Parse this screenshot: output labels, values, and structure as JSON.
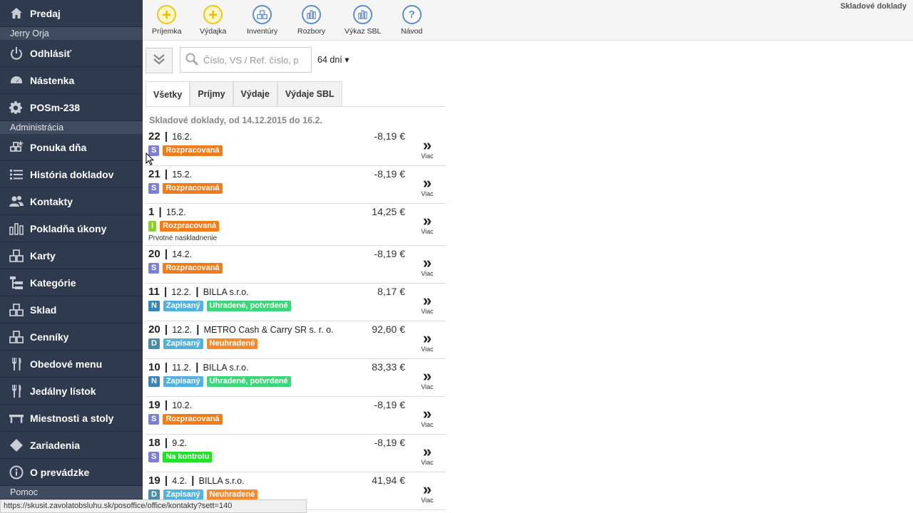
{
  "sidebar": {
    "top_item": {
      "label": "Predaj",
      "icon": "home-icon"
    },
    "user_name": "Jerry Orja",
    "logout": {
      "label": "Odhlásiť",
      "icon": "power-icon"
    },
    "dashboard": {
      "label": "Nástenka",
      "icon": "dashboard-icon"
    },
    "pos": {
      "label": "POSm-238",
      "icon": "gear-icon"
    },
    "admin_section": "Administrácia",
    "items": [
      {
        "label": "Ponuka dňa",
        "icon": "offer-icon"
      },
      {
        "label": "História dokladov",
        "icon": "list-icon"
      },
      {
        "label": "Kontakty",
        "icon": "users-icon"
      },
      {
        "label": "Pokladňa úkony",
        "icon": "bar-chart-icon"
      },
      {
        "label": "Karty",
        "icon": "cubes-icon"
      },
      {
        "label": "Kategórie",
        "icon": "tree-icon"
      },
      {
        "label": "Sklad",
        "icon": "warehouse-icon"
      },
      {
        "label": "Cenníky",
        "icon": "price-icon"
      },
      {
        "label": "Obedové menu",
        "icon": "cutlery-icon"
      },
      {
        "label": "Jedálny lístok",
        "icon": "cutlery-icon"
      },
      {
        "label": "Miestnosti a stoly",
        "icon": "table-icon"
      },
      {
        "label": "Zariadenia",
        "icon": "diamond-icon"
      },
      {
        "label": "O prevádzke",
        "icon": "info-icon"
      }
    ],
    "bottom_section": "Pomoc"
  },
  "toolbar": {
    "buttons": [
      {
        "label": "Príjemka",
        "icon": "plus-circle-icon"
      },
      {
        "label": "Výdajka",
        "icon": "plus-circle-icon"
      },
      {
        "label": "Inventúry",
        "icon": "boxes-icon"
      },
      {
        "label": "Rozbory",
        "icon": "chart-icon"
      },
      {
        "label": "Výkaz SBL",
        "icon": "chart-icon"
      },
      {
        "label": "Návod",
        "icon": "question-icon"
      }
    ],
    "page_title": "Skladové doklady"
  },
  "filter": {
    "search_placeholder": "Číslo, VS / Ref. číslo, p",
    "days_selected": "64 dní ▾"
  },
  "tabs": [
    {
      "label": "Všetky",
      "active": true
    },
    {
      "label": "Príjmy",
      "active": false
    },
    {
      "label": "Výdaje",
      "active": false
    },
    {
      "label": "Výdaje SBL",
      "active": false
    }
  ],
  "list_heading": "Skladové doklady, od 14.12.2015 do 16.2.",
  "more_label": "Viac",
  "colors": {
    "S": "#7f7fd0",
    "I": "#8ccc3a",
    "N": "#3b84b8",
    "D": "#4d8ca6",
    "Rozpracovaná": "#f07d19",
    "Zapísaný": "#54b0dc",
    "Uhradené, potvrdené": "#3dd67a",
    "Neuhradené": "#f28a30",
    "Na kontrolu": "#22e02c"
  },
  "records": [
    {
      "num": "22",
      "date": "16.2.",
      "partner": "",
      "amount": "-8,19 €",
      "badges": [
        "S",
        "Rozpracovaná"
      ],
      "note": ""
    },
    {
      "num": "21",
      "date": "15.2.",
      "partner": "",
      "amount": "-8,19 €",
      "badges": [
        "S",
        "Rozpracovaná"
      ],
      "note": ""
    },
    {
      "num": "1",
      "date": "15.2.",
      "partner": "",
      "amount": "14,25 €",
      "badges": [
        "I",
        "Rozpracovaná"
      ],
      "note": "Prvotné naskladnenie"
    },
    {
      "num": "20",
      "date": "14.2.",
      "partner": "",
      "amount": "-8,19 €",
      "badges": [
        "S",
        "Rozpracovaná"
      ],
      "note": ""
    },
    {
      "num": "11",
      "date": "12.2.",
      "partner": "BILLA s.r.o.",
      "amount": "8,17 €",
      "badges": [
        "N",
        "Zapísaný",
        "Uhradené, potvrdené"
      ],
      "note": ""
    },
    {
      "num": "20",
      "date": "12.2.",
      "partner": "METRO Cash & Carry SR s. r. o.",
      "amount": "92,60 €",
      "badges": [
        "D",
        "Zapísaný",
        "Neuhradené"
      ],
      "note": ""
    },
    {
      "num": "10",
      "date": "11.2.",
      "partner": "BILLA s.r.o.",
      "amount": "83,33 €",
      "badges": [
        "N",
        "Zapísaný",
        "Uhradené, potvrdené"
      ],
      "note": ""
    },
    {
      "num": "19",
      "date": "10.2.",
      "partner": "",
      "amount": "-8,19 €",
      "badges": [
        "S",
        "Rozpracovaná"
      ],
      "note": ""
    },
    {
      "num": "18",
      "date": "9.2.",
      "partner": "",
      "amount": "-8,19 €",
      "badges": [
        "S",
        "Na kontrolu"
      ],
      "note": ""
    },
    {
      "num": "19",
      "date": "4.2.",
      "partner": "BILLA s.r.o.",
      "amount": "41,94 €",
      "badges": [
        "D",
        "Zapísaný",
        "Neuhradené"
      ],
      "note": ""
    }
  ],
  "statusbar_url": "https://skusit.zavolatobsluhu.sk/posoffice/office/kontakty?sett=140"
}
